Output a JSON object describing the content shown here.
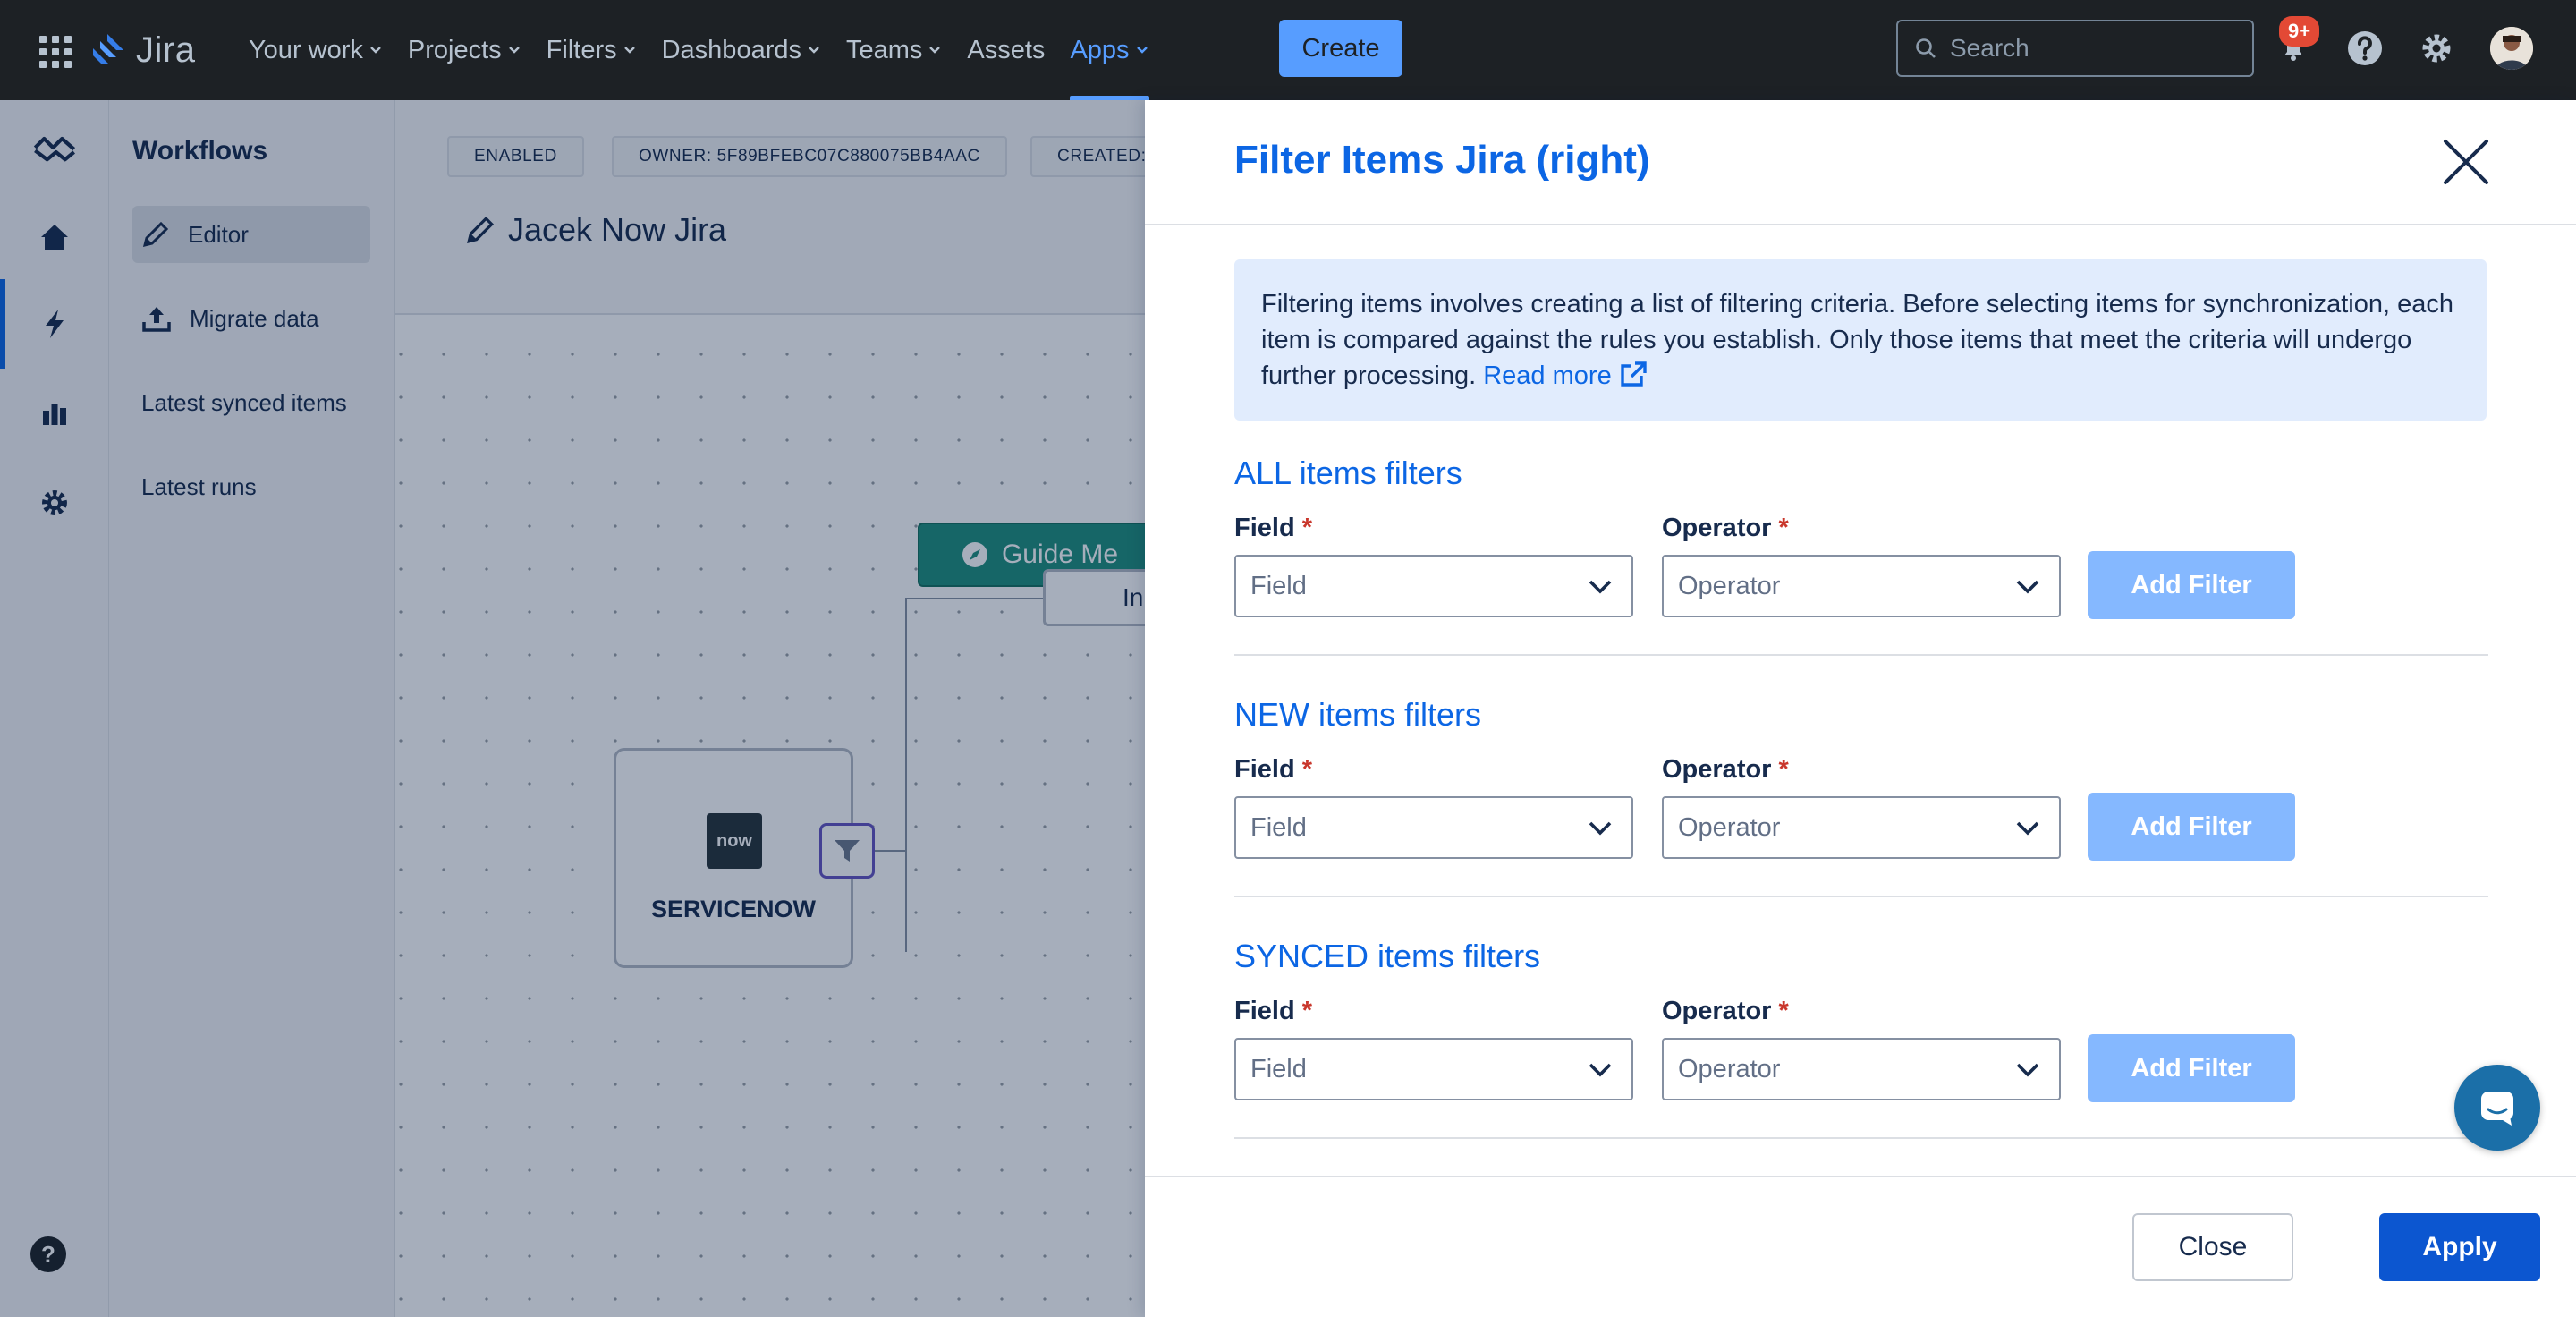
{
  "topnav": {
    "app_name": "Jira",
    "items": [
      {
        "label": "Your work",
        "dropdown": true
      },
      {
        "label": "Projects",
        "dropdown": true
      },
      {
        "label": "Filters",
        "dropdown": true
      },
      {
        "label": "Dashboards",
        "dropdown": true
      },
      {
        "label": "Teams",
        "dropdown": true
      },
      {
        "label": "Assets",
        "dropdown": false
      },
      {
        "label": "Apps",
        "dropdown": true,
        "active": true
      }
    ],
    "create_label": "Create",
    "search_placeholder": "Search",
    "notifications_badge": "9+"
  },
  "rail": {
    "icons": [
      "workflow-logo-icon",
      "home-icon",
      "lightning-icon",
      "bar-chart-icon",
      "gear-icon"
    ],
    "help_label": "?"
  },
  "sidebar": {
    "title": "Workflows",
    "items": [
      {
        "label": "Editor",
        "icon": "pencil-icon",
        "active": true
      },
      {
        "label": "Migrate data",
        "icon": "upload-icon"
      },
      {
        "label": "Latest synced items"
      },
      {
        "label": "Latest runs"
      }
    ]
  },
  "main": {
    "tags": [
      "ENABLED",
      "OWNER: 5F89BFEBC07C880075BB4AAC",
      "CREATED:"
    ],
    "workflow_title": "Jacek Now Jira",
    "guide_me_label": "Guide Me",
    "node_servicenow_logo": "now",
    "node_servicenow_label": "SERVICENOW",
    "node_partial_label": "In"
  },
  "drawer": {
    "title": "Filter Items Jira (right)",
    "info_text": "Filtering items involves creating a list of filtering criteria. Before selecting items for synchronization, each item is compared against the rules you establish. Only those items that meet the criteria will undergo further processing.",
    "info_link": "Read more",
    "field_label": "Field",
    "operator_label": "Operator",
    "required_mark": "*",
    "field_placeholder": "Field",
    "operator_placeholder": "Operator",
    "add_filter_label": "Add Filter",
    "sections": [
      {
        "title": "ALL items filters"
      },
      {
        "title": "NEW items filters"
      },
      {
        "title": "SYNCED items filters"
      }
    ],
    "close_label": "Close",
    "apply_label": "Apply"
  },
  "colors": {
    "topnav_bg": "#1d2125",
    "accent": "#0c66e4",
    "create_button": "#579dff",
    "add_filter_disabled": "#85b8ff",
    "guide_me": "#1f8f7c",
    "info_bg": "#e1ecfd"
  }
}
